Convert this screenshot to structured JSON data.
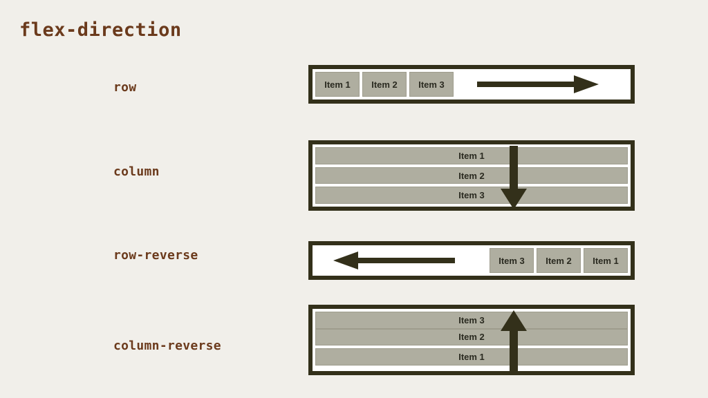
{
  "page": {
    "title": "flex-direction",
    "background_color": "#f1efea",
    "label_color": "#6b3a1c",
    "border_color": "#33301a",
    "item_fill_color": "#afaea0",
    "item_text_color": "#2a2a20",
    "container_fill_color": "#ffffff",
    "arrow_color": "#33301a"
  },
  "examples": [
    {
      "label": "row",
      "direction": "row",
      "arrow": "arrow-right-icon",
      "items": [
        "Item 1",
        "Item 2",
        "Item 3"
      ]
    },
    {
      "label": "column",
      "direction": "column",
      "arrow": "arrow-down-icon",
      "items": [
        "Item 1",
        "Item 2",
        "Item 3"
      ]
    },
    {
      "label": "row-reverse",
      "direction": "row-reverse",
      "arrow": "arrow-left-icon",
      "items": [
        "Item 1",
        "Item 2",
        "Item 3"
      ]
    },
    {
      "label": "column-reverse",
      "direction": "column-reverse",
      "arrow": "arrow-up-icon",
      "items": [
        "Item 1",
        "Item 2",
        "Item 3"
      ]
    }
  ]
}
